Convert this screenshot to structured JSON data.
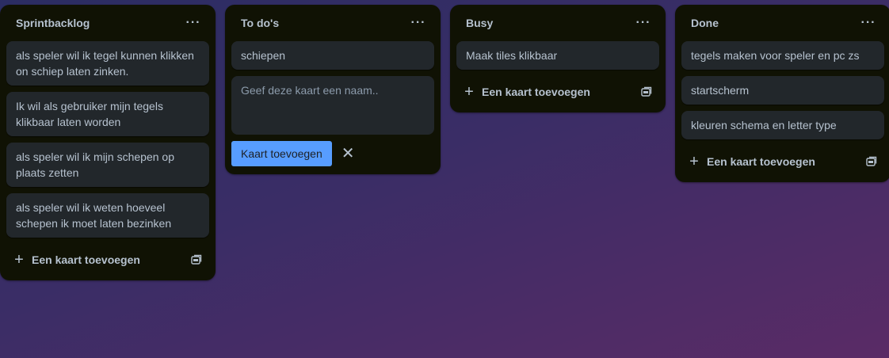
{
  "lists": [
    {
      "title": "Sprintbacklog",
      "cards": [
        "als speler wil ik tegel kunnen klikken on schiep laten zinken.",
        "Ik wil als gebruiker mijn tegels klikbaar laten worden",
        "als speler wil ik mijn schepen op plaats zetten",
        "als speler wil ik weten hoeveel schepen ik moet laten bezinken"
      ],
      "add_label": "Een kaart toevoegen"
    },
    {
      "title": "To do's",
      "cards": [
        "schiepen"
      ],
      "composer_placeholder": "Geef deze kaart een naam..",
      "composer_submit": "Kaart toevoegen"
    },
    {
      "title": "Busy",
      "cards": [
        "Maak tiles klikbaar"
      ],
      "add_label": "Een kaart toevoegen"
    },
    {
      "title": "Done",
      "cards": [
        "tegels maken voor speler en pc zs",
        "startscherm",
        "kleuren schema en letter type"
      ],
      "add_label": "Een kaart toevoegen"
    }
  ],
  "icons": {
    "menu": "ellipsis-icon",
    "add": "plus-icon",
    "template": "card-template-icon",
    "close": "close-icon"
  },
  "colors": {
    "list_bg": "#101204",
    "card_bg": "#22272b",
    "text": "#b6c2cf",
    "primary_button": "#579dff"
  }
}
